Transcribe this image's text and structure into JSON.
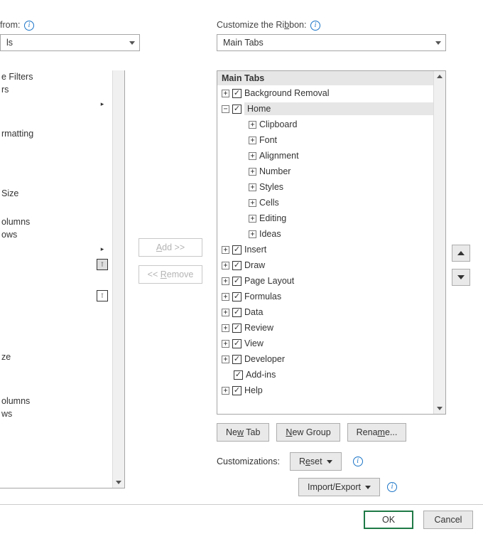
{
  "left": {
    "section_label_fragment": "from:",
    "combo_value_fragment": "ls",
    "items": [
      "e Filters",
      "rs",
      "",
      "",
      "rmatting",
      "",
      "",
      "",
      "Size",
      "",
      "olumns",
      "ows",
      "",
      "",
      "",
      "",
      "",
      "",
      "",
      "ze",
      "",
      "",
      "olumns",
      "ws"
    ]
  },
  "middle": {
    "add_label": "Add >>",
    "remove_label": "<< Remove"
  },
  "right": {
    "section_label": "Customize the Ribbon:",
    "combo_value": "Main Tabs",
    "tree_header": "Main Tabs",
    "tabs": [
      {
        "label": "Background Removal",
        "expanded": false,
        "checked": true,
        "children": []
      },
      {
        "label": "Home",
        "expanded": true,
        "checked": true,
        "selected": true,
        "children": [
          "Clipboard",
          "Font",
          "Alignment",
          "Number",
          "Styles",
          "Cells",
          "Editing",
          "Ideas"
        ]
      },
      {
        "label": "Insert",
        "expanded": false,
        "checked": true
      },
      {
        "label": "Draw",
        "expanded": false,
        "checked": true
      },
      {
        "label": "Page Layout",
        "expanded": false,
        "checked": true
      },
      {
        "label": "Formulas",
        "expanded": false,
        "checked": true
      },
      {
        "label": "Data",
        "expanded": false,
        "checked": true
      },
      {
        "label": "Review",
        "expanded": false,
        "checked": true
      },
      {
        "label": "View",
        "expanded": false,
        "checked": true
      },
      {
        "label": "Developer",
        "expanded": false,
        "checked": true
      },
      {
        "label": "Add-ins",
        "expanded": null,
        "checked": true
      },
      {
        "label": "Help",
        "expanded": false,
        "checked": true
      }
    ],
    "buttons": {
      "new_tab": "New Tab",
      "new_group": "New Group",
      "rename": "Rename...",
      "customizations_label": "Customizations:",
      "reset": "Reset",
      "import_export": "Import/Export"
    }
  },
  "footer": {
    "ok": "OK",
    "cancel": "Cancel"
  }
}
